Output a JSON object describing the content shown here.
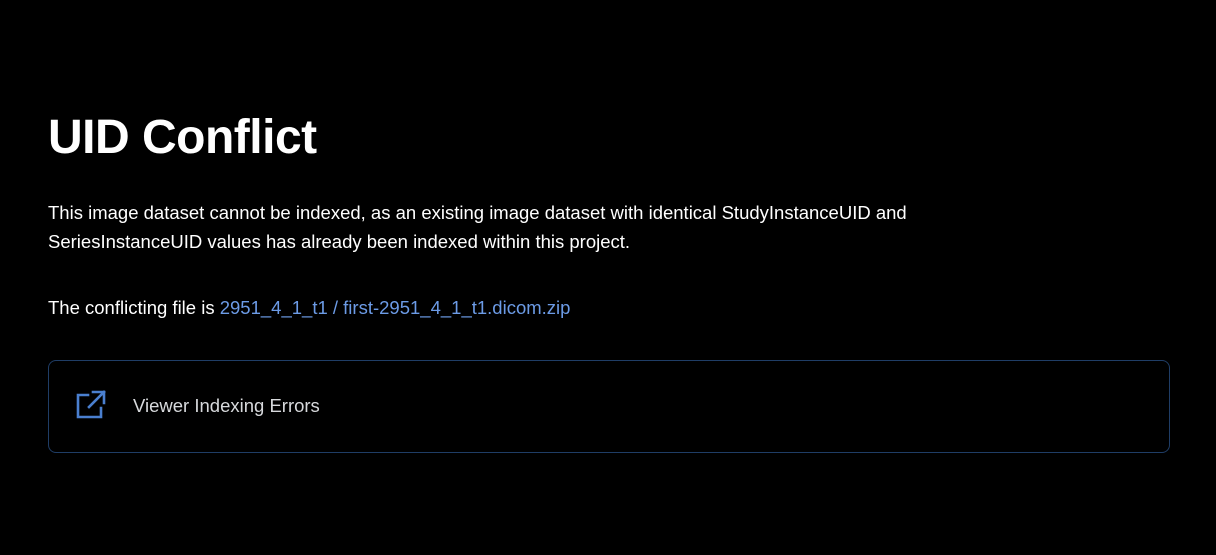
{
  "page": {
    "title": "UID Conflict",
    "description": "This image dataset cannot be indexed, as an existing image dataset with identical StudyInstanceUID and SeriesInstanceUID values has already been indexed within this project.",
    "conflict_prefix": "The conflicting file is ",
    "conflict_file": "2951_4_1_t1 / first-2951_4_1_t1.dicom.zip"
  },
  "card": {
    "label": "Viewer Indexing Errors",
    "icon": "external-link-icon"
  },
  "colors": {
    "background": "#000000",
    "text": "#ffffff",
    "link": "#6c9be6",
    "card_border": "#1f3d66",
    "icon": "#4a7fcf"
  }
}
